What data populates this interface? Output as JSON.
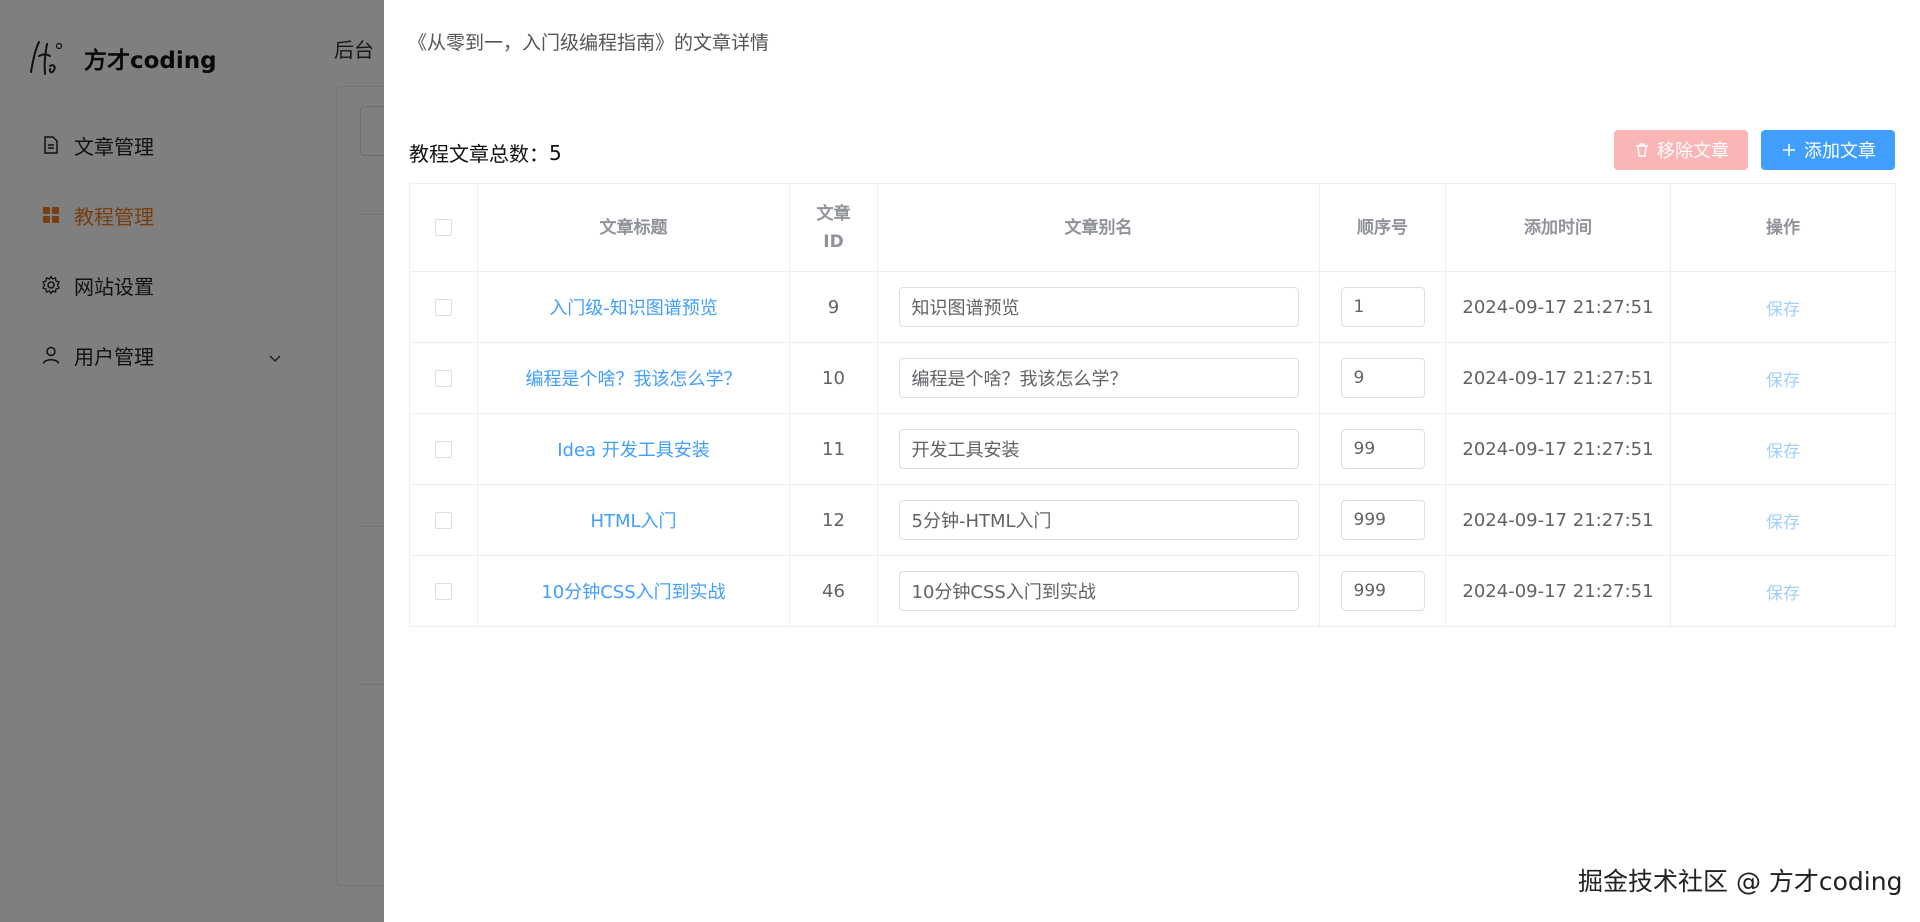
{
  "app": {
    "brand_name": "方才coding",
    "topbar_label": "后台",
    "menu": [
      {
        "label": "文章管理",
        "icon": "document-icon",
        "active": false
      },
      {
        "label": "教程管理",
        "icon": "grid-icon",
        "active": true
      },
      {
        "label": "网站设置",
        "icon": "gear-icon",
        "active": false
      },
      {
        "label": "用户管理",
        "icon": "user-icon",
        "active": false,
        "has_submenu": true
      }
    ]
  },
  "drawer": {
    "title": "《从零到一，入门级编程指南》的文章详情",
    "count_label": "教程文章总数：",
    "count_value": "5",
    "remove_button": "移除文章",
    "add_button": "添加文章",
    "columns": [
      "文章标题",
      "文章ID",
      "文章别名",
      "顺序号",
      "添加时间",
      "操作"
    ],
    "column_id_parts": [
      "文章",
      "ID"
    ],
    "rows": [
      {
        "title": "入门级-知识图谱预览",
        "id": "9",
        "alias": "知识图谱预览",
        "order": "1",
        "time": "2024-09-17 21:27:51",
        "action": "保存"
      },
      {
        "title": "编程是个啥？我该怎么学？",
        "id": "10",
        "alias": "编程是个啥？我该怎么学？",
        "order": "9",
        "time": "2024-09-17 21:27:51",
        "action": "保存"
      },
      {
        "title": "Idea 开发工具安装",
        "id": "11",
        "alias": "开发工具安装",
        "order": "99",
        "time": "2024-09-17 21:27:51",
        "action": "保存"
      },
      {
        "title": "HTML入门",
        "id": "12",
        "alias": "5分钟-HTML入门",
        "order": "999",
        "time": "2024-09-17 21:27:51",
        "action": "保存"
      },
      {
        "title": "10分钟CSS入门到实战",
        "id": "46",
        "alias": "10分钟CSS入门到实战",
        "order": "999",
        "time": "2024-09-17 21:27:51",
        "action": "保存"
      }
    ]
  },
  "watermark": "掘金技术社区 @ 方才coding",
  "colors": {
    "accent": "#409eff",
    "active_menu": "#f07c1e",
    "danger_light": "#fab6b6",
    "link_light": "#a0cfff"
  }
}
